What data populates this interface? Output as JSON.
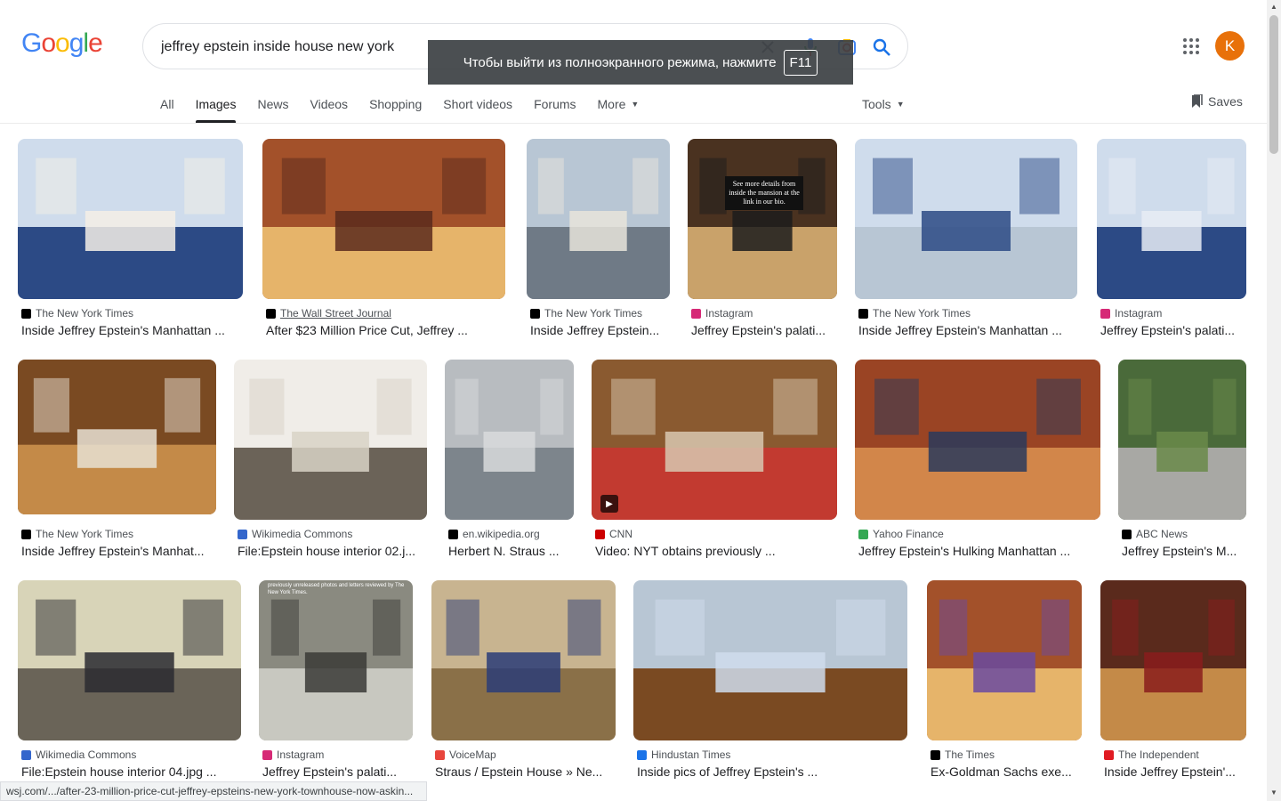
{
  "header": {
    "logo_letters": [
      {
        "ch": "G",
        "color": "#4285F4"
      },
      {
        "ch": "o",
        "color": "#EA4335"
      },
      {
        "ch": "o",
        "color": "#FBBC05"
      },
      {
        "ch": "g",
        "color": "#4285F4"
      },
      {
        "ch": "l",
        "color": "#34A853"
      },
      {
        "ch": "e",
        "color": "#EA4335"
      }
    ],
    "search_value": "jeffrey epstein inside house new york",
    "avatar_letter": "K",
    "avatar_color": "#e8710a",
    "fullscreen_notice": "Чтобы выйти из полноэкранного режима, нажмите",
    "fullscreen_key": "F11"
  },
  "tabs": {
    "items": [
      "All",
      "Images",
      "News",
      "Videos",
      "Shopping",
      "Short videos",
      "Forums",
      "More"
    ],
    "active": "Images",
    "tools": "Tools",
    "saves": "Saves"
  },
  "results": [
    {
      "source": "The New York Times",
      "title": "Inside Jeffrey Epstein's Manhattan ...",
      "fav": "#000000"
    },
    {
      "source": "The Wall Street Journal",
      "title": "After $23 Million Price Cut, Jeffrey ...",
      "fav": "#000000"
    },
    {
      "source": "The New York Times",
      "title": "Inside Jeffrey Epstein...",
      "fav": "#000000"
    },
    {
      "source": "Instagram",
      "title": "Jeffrey Epstein's palati...",
      "fav": "#d62976"
    },
    {
      "source": "The New York Times",
      "title": "Inside Jeffrey Epstein's Manhattan ...",
      "fav": "#000000"
    },
    {
      "source": "Instagram",
      "title": "Jeffrey Epstein's palati...",
      "fav": "#d62976"
    },
    {
      "source": "The New York Times",
      "title": "Inside Jeffrey Epstein's Manhat...",
      "fav": "#000000"
    },
    {
      "source": "Wikimedia Commons",
      "title": "File:Epstein house interior 02.j...",
      "fav": "#3366cc"
    },
    {
      "source": "en.wikipedia.org",
      "title": "Herbert N. Straus ...",
      "fav": "#000000"
    },
    {
      "source": "CNN",
      "title": "Video: NYT obtains previously ...",
      "fav": "#cc0000"
    },
    {
      "source": "Yahoo Finance",
      "title": "Jeffrey Epstein's Hulking Manhattan ...",
      "fav": "#34A853"
    },
    {
      "source": "ABC News",
      "title": "Jeffrey Epstein's M...",
      "fav": "#000000"
    },
    {
      "source": "Wikimedia Commons",
      "title": "File:Epstein house interior 04.jpg ...",
      "fav": "#3366cc"
    },
    {
      "source": "Instagram",
      "title": "Jeffrey Epstein's palati...",
      "fav": "#d62976"
    },
    {
      "source": "VoiceMap",
      "title": "Straus / Epstein House » Ne...",
      "fav": "#e8453c"
    },
    {
      "source": "Hindustan Times",
      "title": "Inside pics of Jeffrey Epstein's ...",
      "fav": "#1a73e8"
    },
    {
      "source": "The Times",
      "title": "Ex-Goldman Sachs exe...",
      "fav": "#000000"
    },
    {
      "source": "The Independent",
      "title": "Inside Jeffrey Epstein'...",
      "fav": "#e01b22"
    }
  ],
  "thumb_text": {
    "r4": "See more details from inside the mansion at the link in our bio.",
    "r14": "previously unreleased photos and letters reviewed by The New York Times."
  },
  "status_url": "wsj.com/.../after-23-million-price-cut-jeffrey-epsteins-new-york-townhouse-now-askin..."
}
